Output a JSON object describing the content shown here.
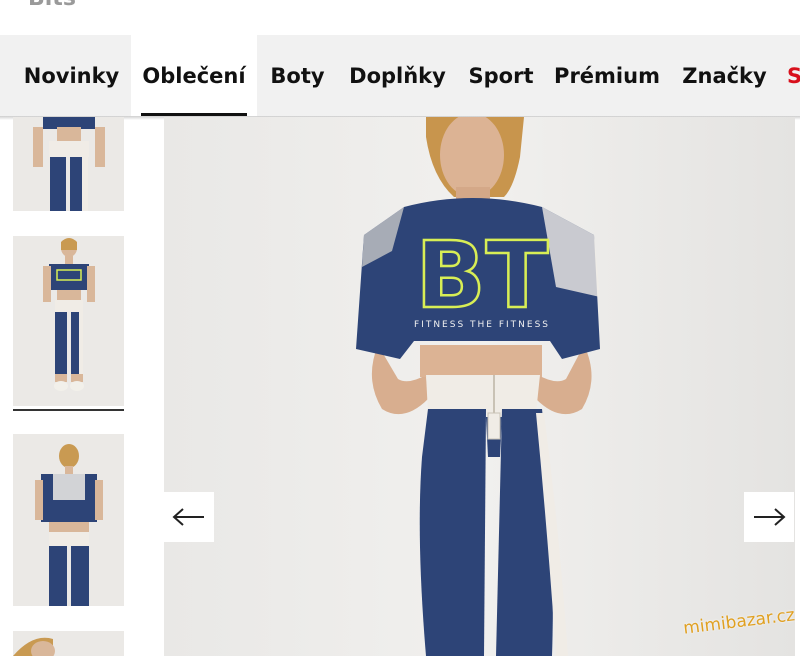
{
  "brand_partial": "Bits",
  "nav": {
    "tabs": [
      {
        "label": "Novinky"
      },
      {
        "label": "Oblečení"
      },
      {
        "label": "Boty"
      },
      {
        "label": "Doplňky"
      },
      {
        "label": "Sport"
      },
      {
        "label": "Prémium"
      },
      {
        "label": "Značky"
      },
      {
        "label": "S"
      }
    ],
    "active_index": 1
  },
  "product": {
    "graphic_text": "BT",
    "shirt_slogan": "FITNESS THE FITNESS"
  },
  "carousel": {
    "prev_icon": "arrow-left-icon",
    "next_icon": "arrow-right-icon"
  },
  "watermark": "mimibazar.cz",
  "colors": {
    "navy": "#2d4477",
    "accent_lime": "#d8ee55",
    "sale_red": "#d8101c",
    "cream": "#f0ece6"
  }
}
